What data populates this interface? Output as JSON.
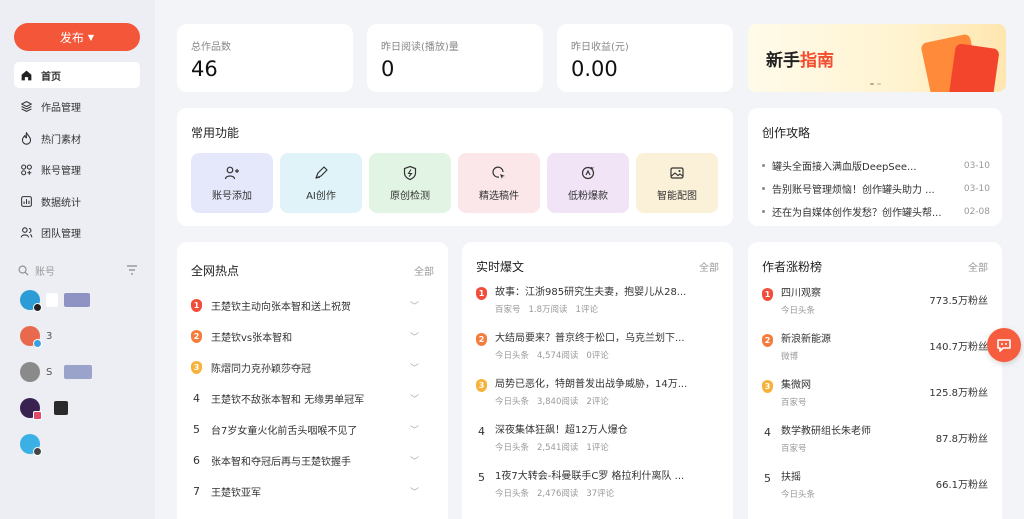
{
  "sidebar": {
    "publish_label": "发布",
    "nav": [
      {
        "label": "首页",
        "icon": "home-icon",
        "active": true
      },
      {
        "label": "作品管理",
        "icon": "layers-icon"
      },
      {
        "label": "热门素材",
        "icon": "fire-icon"
      },
      {
        "label": "账号管理",
        "icon": "accounts-icon"
      },
      {
        "label": "数据统计",
        "icon": "stats-icon"
      },
      {
        "label": "团队管理",
        "icon": "team-icon"
      }
    ],
    "account_search_placeholder": "账号",
    "accounts": [
      {
        "label": ""
      },
      {
        "label": "3"
      },
      {
        "label": "S"
      },
      {
        "label": ""
      },
      {
        "label": ""
      }
    ]
  },
  "stats": [
    {
      "label": "总作品数",
      "value": "46"
    },
    {
      "label": "昨日阅读(播放)量",
      "value": "0"
    },
    {
      "label": "昨日收益(元)",
      "value": "0.00"
    }
  ],
  "guide": {
    "title_prefix": "新手",
    "title_highlight": "指南"
  },
  "functions": {
    "title": "常用功能",
    "items": [
      {
        "label": "账号添加",
        "icon": "add-user-icon",
        "bg": "#e5e8fb"
      },
      {
        "label": "AI创作",
        "icon": "ai-pen-icon",
        "bg": "#dff3f8"
      },
      {
        "label": "原创检测",
        "icon": "shield-check-icon",
        "bg": "#e2f4e3"
      },
      {
        "label": "精选稿件",
        "icon": "select-icon",
        "bg": "#fbe7ea"
      },
      {
        "label": "低粉爆款",
        "icon": "fan-viral-icon",
        "bg": "#f1e4f7"
      },
      {
        "label": "智能配图",
        "icon": "image-icon",
        "bg": "#fbf1d9"
      }
    ]
  },
  "strategy": {
    "title": "创作攻略",
    "items": [
      {
        "title": "罐头全面接入满血版DeepSee...",
        "date": "03-10"
      },
      {
        "title": "告别账号管理烦恼！创作罐头助力 ...",
        "date": "03-10"
      },
      {
        "title": "还在为自媒体创作发愁？创作罐头帮...",
        "date": "02-08"
      }
    ]
  },
  "hot": {
    "title": "全网热点",
    "more": "全部",
    "items": [
      {
        "rank": "1",
        "title": "王楚钦主动向张本智和送上祝贺"
      },
      {
        "rank": "2",
        "title": "王楚钦vs张本智和"
      },
      {
        "rank": "3",
        "title": "陈熠同力克孙颖莎夺冠"
      },
      {
        "rank": "4",
        "title": "王楚钦不敌张本智和 无缘男单冠军"
      },
      {
        "rank": "5",
        "title": "台7岁女童火化前舌头咽喉不见了"
      },
      {
        "rank": "6",
        "title": "张本智和夺冠后再与王楚钦握手"
      },
      {
        "rank": "7",
        "title": "王楚钦亚军"
      }
    ]
  },
  "news": {
    "title": "实时爆文",
    "more": "全部",
    "items": [
      {
        "rank": "1",
        "title": "故事：江浙985研究生夫妻，抱婴儿从28...",
        "source": "百家号",
        "reads": "1.8万阅读",
        "comments": "1评论"
      },
      {
        "rank": "2",
        "title": "大结局要来？普京终于松口，乌克兰划下...",
        "source": "今日头条",
        "reads": "4,574阅读",
        "comments": "0评论"
      },
      {
        "rank": "3",
        "title": "局势已恶化，特朗普发出战争威胁，14万...",
        "source": "今日头条",
        "reads": "3,840阅读",
        "comments": "2评论"
      },
      {
        "rank": "4",
        "title": "深夜集体狂飙！超12万人爆仓",
        "source": "今日头条",
        "reads": "2,541阅读",
        "comments": "1评论"
      },
      {
        "rank": "5",
        "title": "1夜7大转会-科曼联手C罗 格拉利什离队 ...",
        "source": "今日头条",
        "reads": "2,476阅读",
        "comments": "37评论"
      }
    ]
  },
  "fans": {
    "title": "作者涨粉榜",
    "more": "全部",
    "items": [
      {
        "rank": "1",
        "name": "四川观察",
        "platform": "今日头条",
        "count": "773.5万粉丝"
      },
      {
        "rank": "2",
        "name": "新浪新能源",
        "platform": "微博",
        "count": "140.7万粉丝"
      },
      {
        "rank": "3",
        "name": "集微网",
        "platform": "百家号",
        "count": "125.8万粉丝"
      },
      {
        "rank": "4",
        "name": "数学教研组长朱老师",
        "platform": "百家号",
        "count": "87.8万粉丝"
      },
      {
        "rank": "5",
        "name": "扶摇",
        "platform": "今日头条",
        "count": "66.1万粉丝"
      }
    ]
  },
  "colors": {
    "accent": "#f4563a",
    "rank1": "#f24d3a",
    "rank2": "#f47c3c",
    "rank3": "#f7b23b"
  }
}
